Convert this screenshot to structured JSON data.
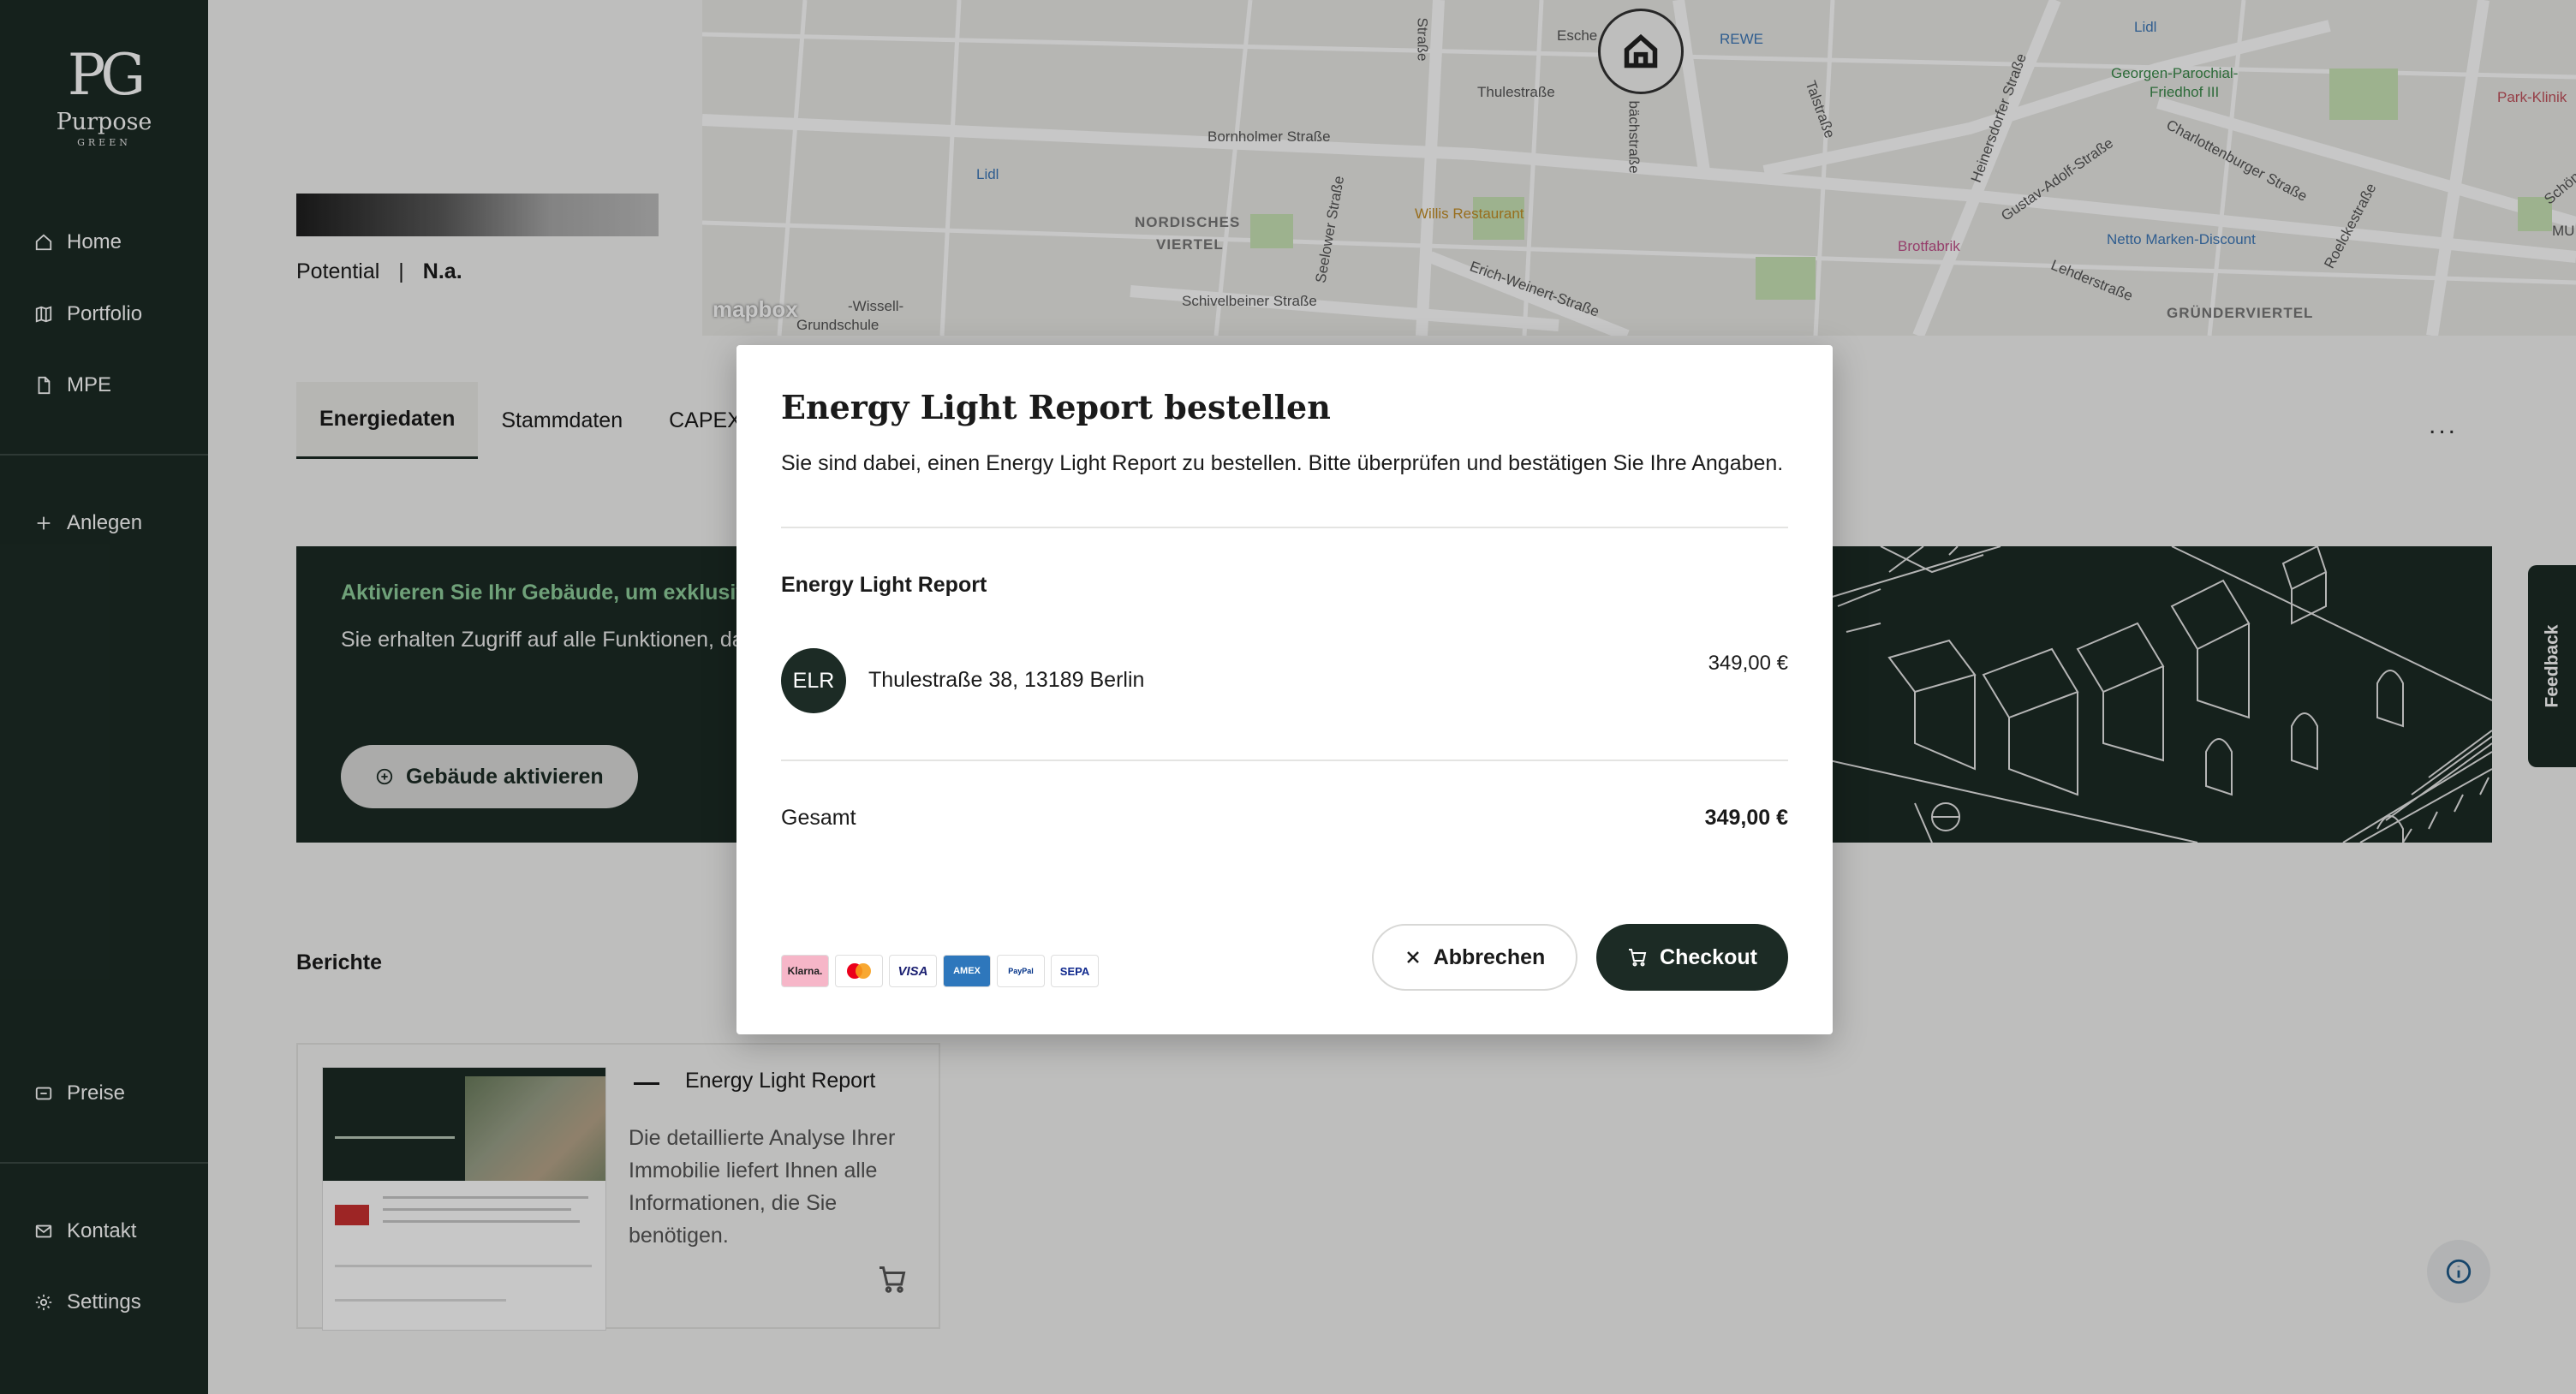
{
  "brand": {
    "mark": "PG",
    "name": "Purpose",
    "sub": "GREEN"
  },
  "sidebar": {
    "items": [
      {
        "label": "Home",
        "icon": "home-icon"
      },
      {
        "label": "Portfolio",
        "icon": "map-icon"
      },
      {
        "label": "MPE",
        "icon": "document-icon"
      },
      {
        "label": "Anlegen",
        "icon": "plus-icon"
      },
      {
        "label": "Preise",
        "icon": "tag-icon"
      },
      {
        "label": "Kontakt",
        "icon": "mail-icon"
      },
      {
        "label": "Settings",
        "icon": "gear-icon"
      }
    ]
  },
  "header": {
    "potential_label": "Potential",
    "separator": "|",
    "potential_value": "N.a."
  },
  "map": {
    "labels": [
      "Bornholmer Straße",
      "NORDISCHES",
      "VIERTEL",
      "Schivelbeiner Straße",
      "Erich-Weinert-Straße",
      "Thulestraße",
      "Seelower Straße",
      "Talstraße",
      "Heinersdorfer Straße",
      "Gustav-Adolf-Straße",
      "Charlottenburger Straße",
      "Lehderstraße",
      "Roelckestraße",
      "GRÜNDERVIERTEL",
      "Georgen-Parochial-",
      "Friedhof III",
      "Park-Klinik",
      "Lidl",
      "Lidl",
      "REWE",
      "Willis Restaurant",
      "Brotfabrik",
      "Netto Marken-Discount",
      "Esche",
      "Schön",
      "MU",
      "-Wissell-",
      "Grundschule",
      "bächstraße",
      "Straße"
    ],
    "logo": "mapbox"
  },
  "tabs": [
    "Energiedaten",
    "Stammdaten",
    "CAPEX"
  ],
  "more": "...",
  "banner": {
    "title": "Aktivieren Sie Ihr Gebäude, um exklusive E",
    "text": "Sie erhalten Zugriff auf alle Funktionen, dar Rechner.",
    "button": "Gebäude aktivieren"
  },
  "reports": {
    "title": "Berichte",
    "card": {
      "name": "Energy Light Report",
      "description": "Die detaillierte Analyse Ihrer Immobilie liefert Ihnen alle Informationen, die Sie benötigen."
    }
  },
  "feedback": "Feedback",
  "modal": {
    "title": "Energy Light Report bestellen",
    "subtitle": "Sie sind dabei, einen Energy Light Report zu bestellen. Bitte überprüfen und bestätigen Sie Ihre Angaben.",
    "section": "Energy Light Report",
    "avatar": "ELR",
    "address": "Thulestraße 38, 13189 Berlin",
    "price": "349,00 €",
    "total_label": "Gesamt",
    "total_price": "349,00 €",
    "payment_methods": [
      "Klarna.",
      "Mastercard",
      "VISA",
      "AMEX",
      "PayPal",
      "SEPA"
    ],
    "cancel": "Abbrechen",
    "checkout": "Checkout"
  },
  "colors": {
    "primary": "#1c2b25",
    "accent": "#8fcf9b",
    "background": "#f4f4f2"
  }
}
